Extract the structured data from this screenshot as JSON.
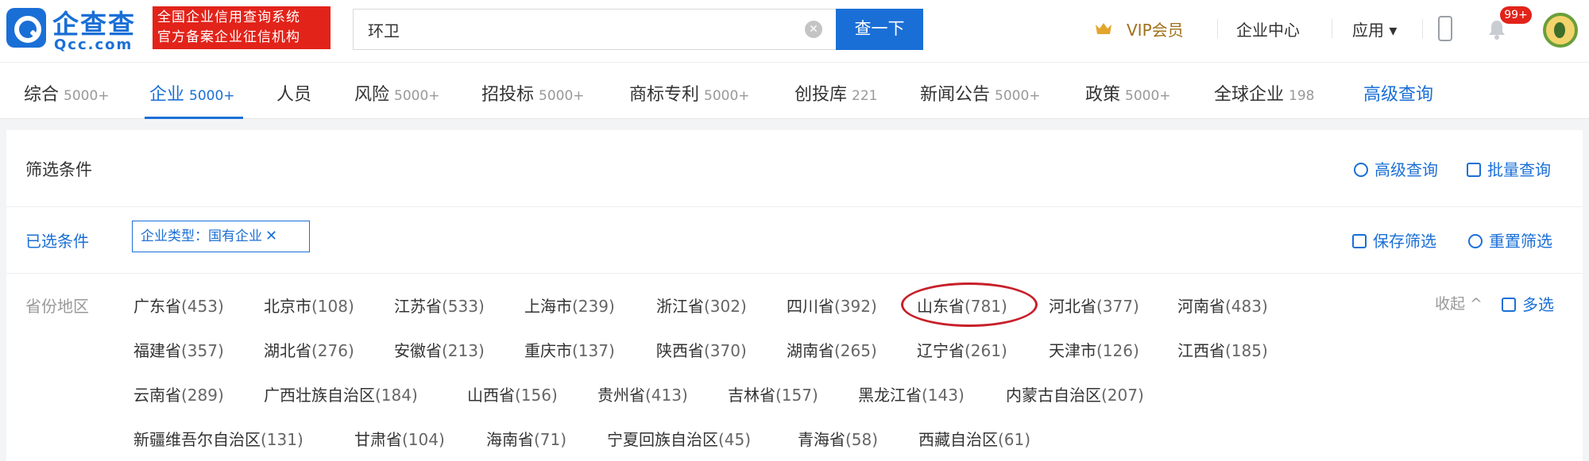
{
  "header": {
    "logo_cn": "企查查",
    "logo_en": "Qcc.com",
    "badge_line1": "全国企业信用查询系统",
    "badge_line2": "官方备案企业征信机构",
    "search_value": "环卫",
    "search_button": "查一下",
    "vip_label": "VIP会员",
    "enterprise_center": "企业中心",
    "apps_label": "应用 ▾",
    "notification_badge": "99+"
  },
  "tabs": [
    {
      "label": "综合",
      "count": "5000+"
    },
    {
      "label": "企业",
      "count": "5000+"
    },
    {
      "label": "人员",
      "count": ""
    },
    {
      "label": "风险",
      "count": "5000+"
    },
    {
      "label": "招投标",
      "count": "5000+"
    },
    {
      "label": "商标专利",
      "count": "5000+"
    },
    {
      "label": "创投库",
      "count": "221"
    },
    {
      "label": "新闻公告",
      "count": "5000+"
    },
    {
      "label": "政策",
      "count": "5000+"
    },
    {
      "label": "全球企业",
      "count": "198"
    },
    {
      "label": "高级查询",
      "count": ""
    }
  ],
  "filter": {
    "title": "筛选条件",
    "advanced_query": "高级查询",
    "batch_query": "批量查询",
    "selected_label": "已选条件",
    "selected_chip": "企业类型：国有企业",
    "chip_close": "✕",
    "save_filter": "保存筛选",
    "reset_filter": "重置筛选",
    "province_label": "省份地区",
    "collapse": "收起 ^",
    "multi_select": "多选"
  },
  "provinces": [
    [
      "广东省",
      "(453)"
    ],
    [
      "北京市",
      "(108)"
    ],
    [
      "江苏省",
      "(533)"
    ],
    [
      "上海市",
      "(239)"
    ],
    [
      "浙江省",
      "(302)"
    ],
    [
      "四川省",
      "(392)"
    ],
    [
      "山东省",
      "(781)"
    ],
    [
      "河北省",
      "(377)"
    ],
    [
      "河南省",
      "(483)"
    ],
    [
      "福建省",
      "(357)"
    ],
    [
      "湖北省",
      "(276)"
    ],
    [
      "安徽省",
      "(213)"
    ],
    [
      "重庆市",
      "(137)"
    ],
    [
      "陕西省",
      "(370)"
    ],
    [
      "湖南省",
      "(265)"
    ],
    [
      "辽宁省",
      "(261)"
    ],
    [
      "天津市",
      "(126)"
    ],
    [
      "江西省",
      "(185)"
    ],
    [
      "云南省",
      "(289)"
    ],
    [
      "广西壮族自治区",
      "(184)"
    ],
    [
      "山西省",
      "(156)"
    ],
    [
      "贵州省",
      "(413)"
    ],
    [
      "吉林省",
      "(157)"
    ],
    [
      "黑龙江省",
      "(143)"
    ],
    [
      "内蒙古自治区",
      "(207)"
    ],
    [
      "新疆维吾尔自治区",
      "(131)"
    ],
    [
      "甘肃省",
      "(104)"
    ],
    [
      "海南省",
      "(71)"
    ],
    [
      "宁夏回族自治区",
      "(45)"
    ],
    [
      "青海省",
      "(58)"
    ],
    [
      "西藏自治区",
      "(61)"
    ]
  ],
  "colors": {
    "brand": "#1a6fd6",
    "badge_red": "#e2231a",
    "highlight_circle": "#c8202a"
  }
}
